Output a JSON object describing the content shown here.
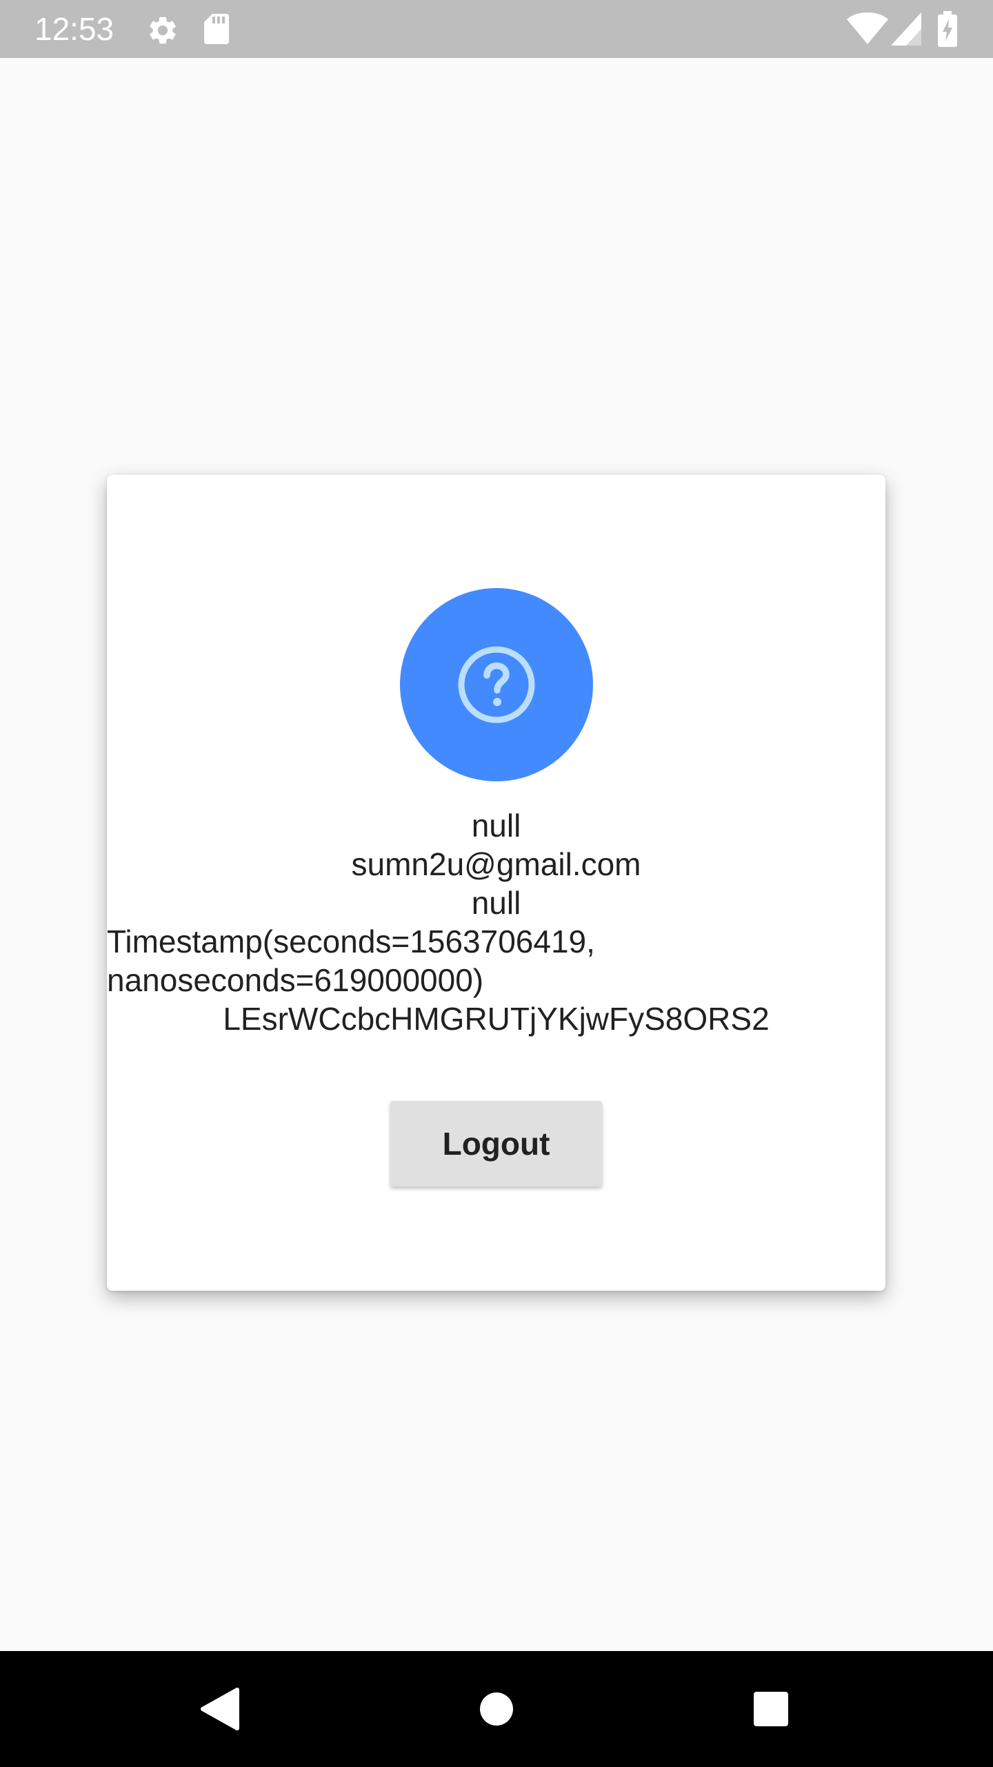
{
  "status_bar": {
    "time": "12:53",
    "icons": [
      "settings-icon",
      "sd-card-icon",
      "wifi-icon",
      "signal-icon",
      "battery-charging-icon"
    ],
    "color": "#bdbdbd"
  },
  "profile": {
    "avatar_icon": "help-circle-icon",
    "avatar_color": "#448aff",
    "name": "null",
    "email": "sumn2u@gmail.com",
    "phone": "null",
    "timestamp_line1": "Timestamp(seconds=1563706419,",
    "timestamp_line2": "nanoseconds=619000000)",
    "uid": "LEsrWCcbcHMGRUTjYKjwFyS8ORS2"
  },
  "actions": {
    "logout_label": "Logout"
  },
  "nav_bar": {
    "buttons": [
      "back-icon",
      "home-icon",
      "recents-icon"
    ]
  }
}
